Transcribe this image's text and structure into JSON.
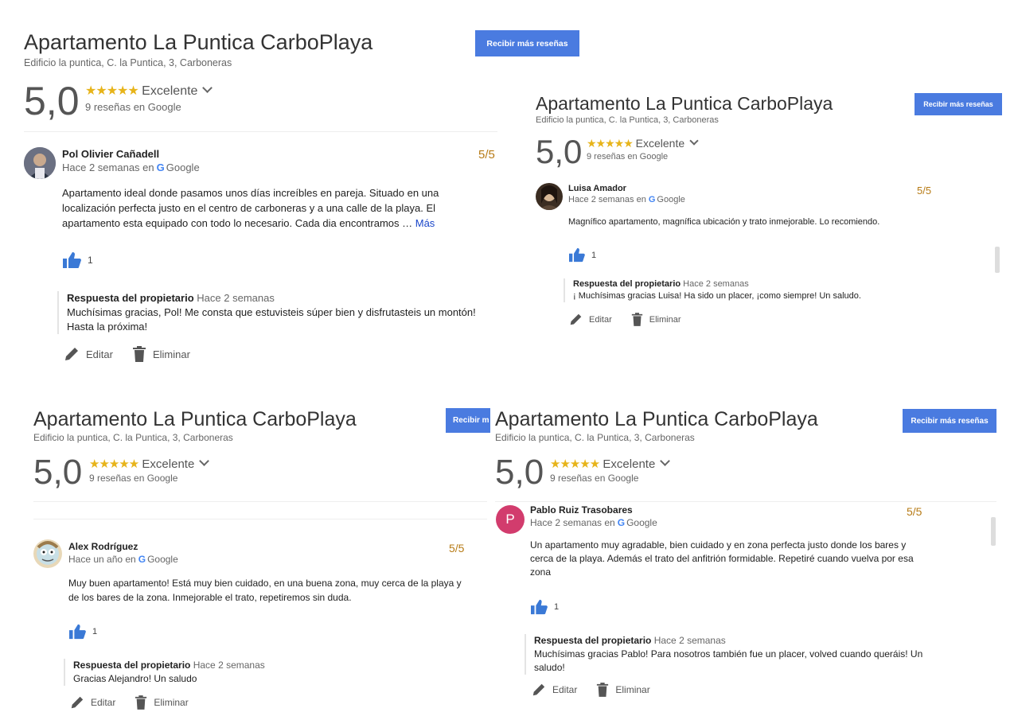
{
  "colors": {
    "accent": "#4a7be0",
    "star": "#e7b41a",
    "score_label": "#b77b16",
    "link": "#1a46c9"
  },
  "place": {
    "name": "Apartamento La Puntica CarboPlaya",
    "address": "Edificio la puntica, C. la Puntica, 3, Carboneras",
    "score": "5,0",
    "stars": "★★★★★",
    "rating_label": "Excelente",
    "review_count": "9 reseñas en Google",
    "button_label": "Recibir más reseñas",
    "button_label_clipped": "Recibir m"
  },
  "labels": {
    "owner_response": "Respuesta del propietario",
    "edit": "Editar",
    "delete": "Eliminar",
    "more": "Más"
  },
  "reviews": [
    {
      "name": "Pol Olivier Cañadell",
      "when": "Hace 2 semanas en",
      "source": "Google",
      "score": "5/5",
      "text": "Apartamento ideal donde pasamos unos días increíbles en pareja. Situado en una localización perfecta justo en el centro de carboneras y a una calle de la playa. El apartamento esta equipado con todo lo necesario. Cada dia encontramos …",
      "likes": "1",
      "response_when": "Hace 2 semanas",
      "response_text": "Muchísimas gracias, Pol! Me consta que estuvisteis súper bien y disfrutasteis un montón! Hasta la próxima!"
    },
    {
      "name": "Luisa Amador",
      "when": "Hace 2 semanas en",
      "source": "Google",
      "score": "5/5",
      "text": "Magnífico apartamento, magnífica ubicación y trato inmejorable. Lo recomiendo.",
      "likes": "1",
      "response_when": "Hace 2 semanas",
      "response_text": "¡ Muchísimas gracias Luisa! Ha sido un placer, ¡como siempre! Un saludo."
    },
    {
      "name": "Alex Rodríguez",
      "when": "Hace un año en",
      "source": "Google",
      "score": "5/5",
      "text": "Muy buen apartamento! Está muy bien cuidado, en una buena zona, muy cerca de la playa y de los bares de la zona. Inmejorable el trato, repetiremos sin duda.",
      "likes": "1",
      "response_when": "Hace 2 semanas",
      "response_text": "Gracias Alejandro! Un saludo"
    },
    {
      "name": "Pablo Ruiz Trasobares",
      "avatar_letter": "P",
      "when": "Hace 2 semanas en",
      "source": "Google",
      "score": "5/5",
      "text": "Un apartamento muy agradable, bien cuidado y en zona perfecta justo donde los bares y cerca de la playa. Además el trato del anfitrión formidable. Repetiré cuando vuelva por esa zona",
      "likes": "1",
      "response_when": "Hace 2 semanas",
      "response_text": "Muchísimas gracias Pablo! Para nosotros también fue un placer, volved cuando queráis! Un saludo!"
    }
  ]
}
